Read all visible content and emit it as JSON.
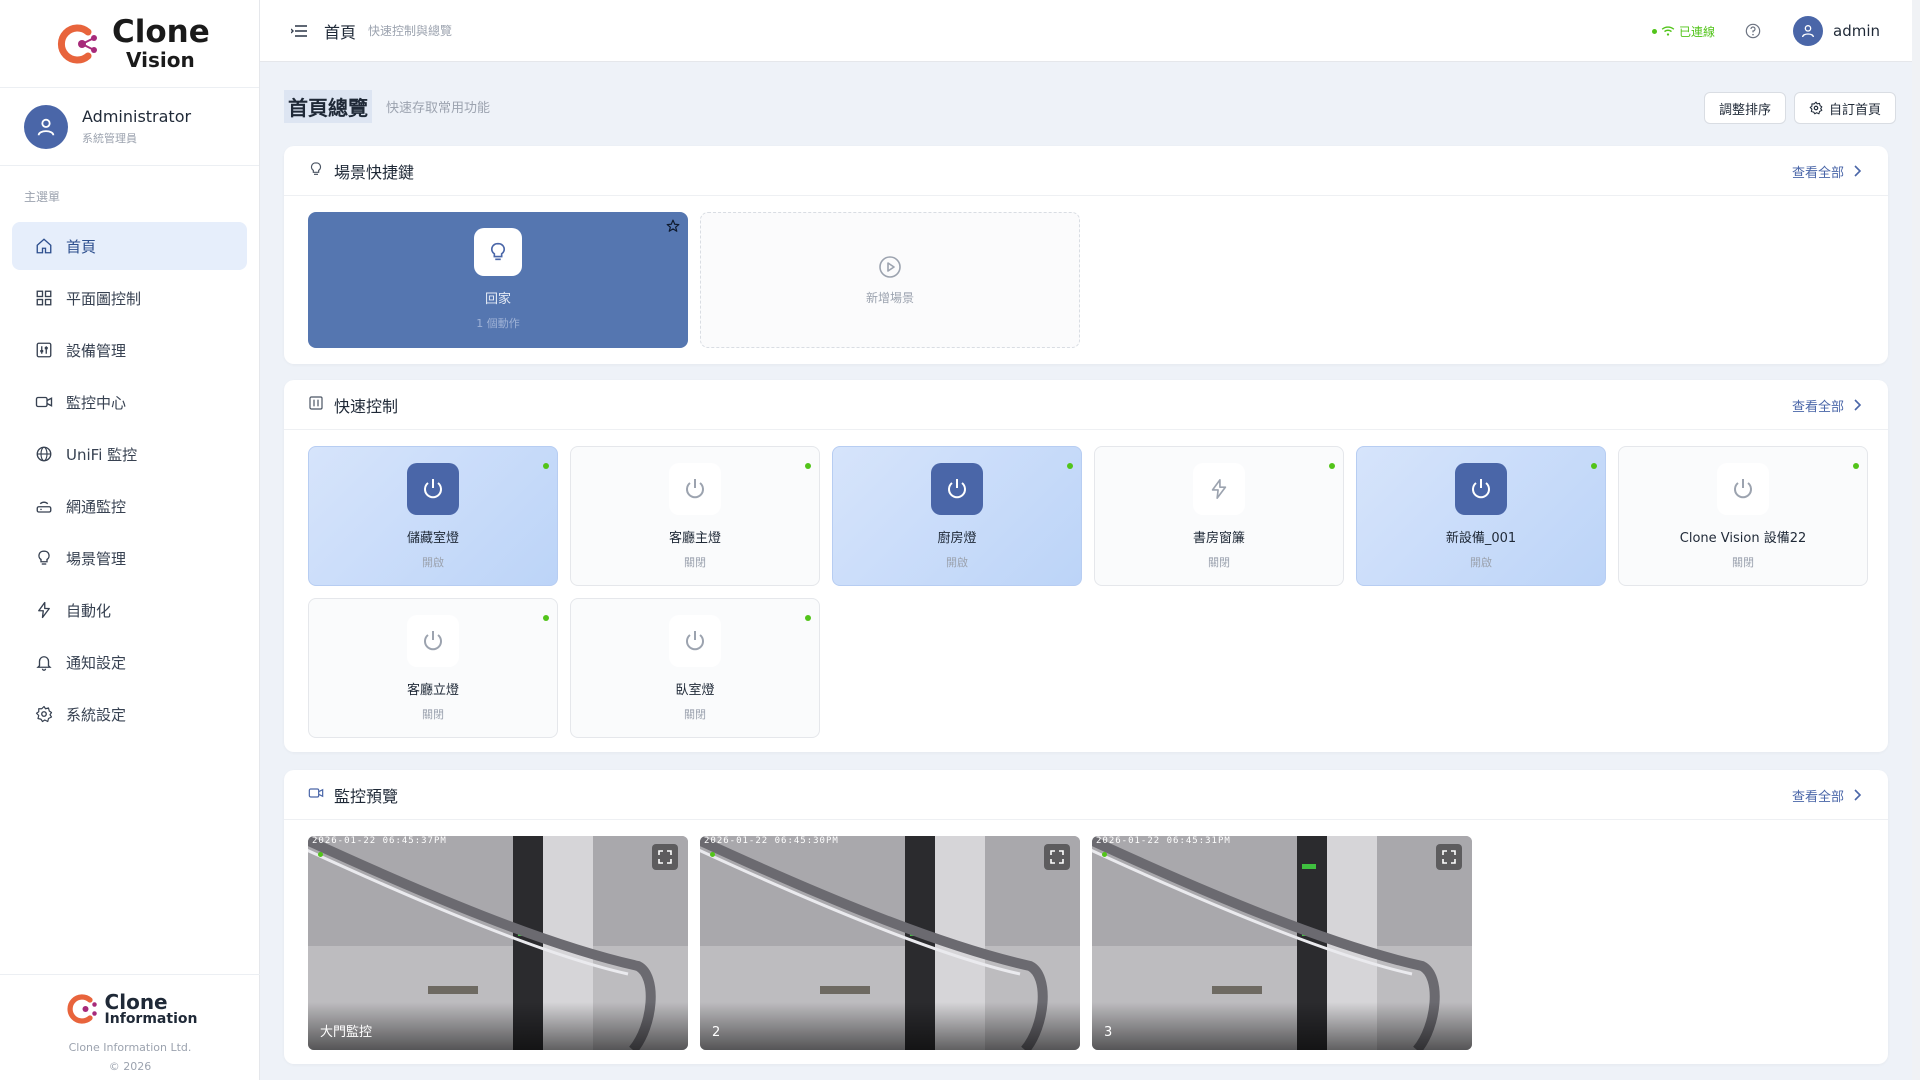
{
  "brand": {
    "name_line1": "Clone",
    "name_line2": "Vision",
    "accent": "#e8643c",
    "accent2": "#a72a7a"
  },
  "user": {
    "name": "Administrator",
    "role": "系統管理員"
  },
  "sidebar": {
    "section_title": "主選單",
    "items": [
      {
        "label": "首頁",
        "icon": "home-icon",
        "active": true
      },
      {
        "label": "平面圖控制",
        "icon": "grid-icon"
      },
      {
        "label": "設備管理",
        "icon": "device-icon"
      },
      {
        "label": "監控中心",
        "icon": "camera-icon"
      },
      {
        "label": "UniFi 監控",
        "icon": "globe-icon"
      },
      {
        "label": "網通監控",
        "icon": "router-icon"
      },
      {
        "label": "場景管理",
        "icon": "bulb-icon"
      },
      {
        "label": "自動化",
        "icon": "bolt-icon"
      },
      {
        "label": "通知設定",
        "icon": "bell-icon"
      },
      {
        "label": "系統設定",
        "icon": "gear-icon"
      }
    ],
    "footer": {
      "logo_line1": "Clone",
      "logo_line2": "Information",
      "company": "Clone Information Ltd.",
      "copyright": "© 2026"
    }
  },
  "topbar": {
    "title": "首頁",
    "subtitle": "快速控制與總覽",
    "connection": "已連線",
    "username": "admin"
  },
  "page": {
    "title": "首頁總覽",
    "subtitle": "快速存取常用功能",
    "actions": {
      "reorder": "調整排序",
      "customize": "自訂首頁"
    }
  },
  "scenes": {
    "title": "場景快捷鍵",
    "view_all": "查看全部",
    "items": [
      {
        "name": "回家",
        "count": "1 個動作"
      }
    ],
    "add_label": "新增場景"
  },
  "quick_control": {
    "title": "快速控制",
    "view_all": "查看全部",
    "items": [
      {
        "name": "儲藏室燈",
        "status": "開啟",
        "on": true,
        "icon": "power-icon"
      },
      {
        "name": "客廳主燈",
        "status": "關閉",
        "on": false,
        "icon": "power-icon"
      },
      {
        "name": "廚房燈",
        "status": "開啟",
        "on": true,
        "icon": "power-icon"
      },
      {
        "name": "書房窗簾",
        "status": "關閉",
        "on": false,
        "icon": "bolt-icon"
      },
      {
        "name": "新設備_001",
        "status": "開啟",
        "on": true,
        "icon": "power-icon"
      },
      {
        "name": "Clone Vision 設備22",
        "status": "關閉",
        "on": false,
        "icon": "power-icon"
      },
      {
        "name": "客廳立燈",
        "status": "關閉",
        "on": false,
        "icon": "power-icon"
      },
      {
        "name": "臥室燈",
        "status": "關閉",
        "on": false,
        "icon": "power-icon"
      }
    ]
  },
  "monitor": {
    "title": "監控預覽",
    "view_all": "查看全部",
    "cameras": [
      {
        "label": "大門監控",
        "timestamp": "2026-01-22 06:45:37PM"
      },
      {
        "label": "2",
        "timestamp": "2026-01-22 06:45:30PM"
      },
      {
        "label": "3",
        "timestamp": "2026-01-22 06:45:31PM"
      }
    ]
  }
}
